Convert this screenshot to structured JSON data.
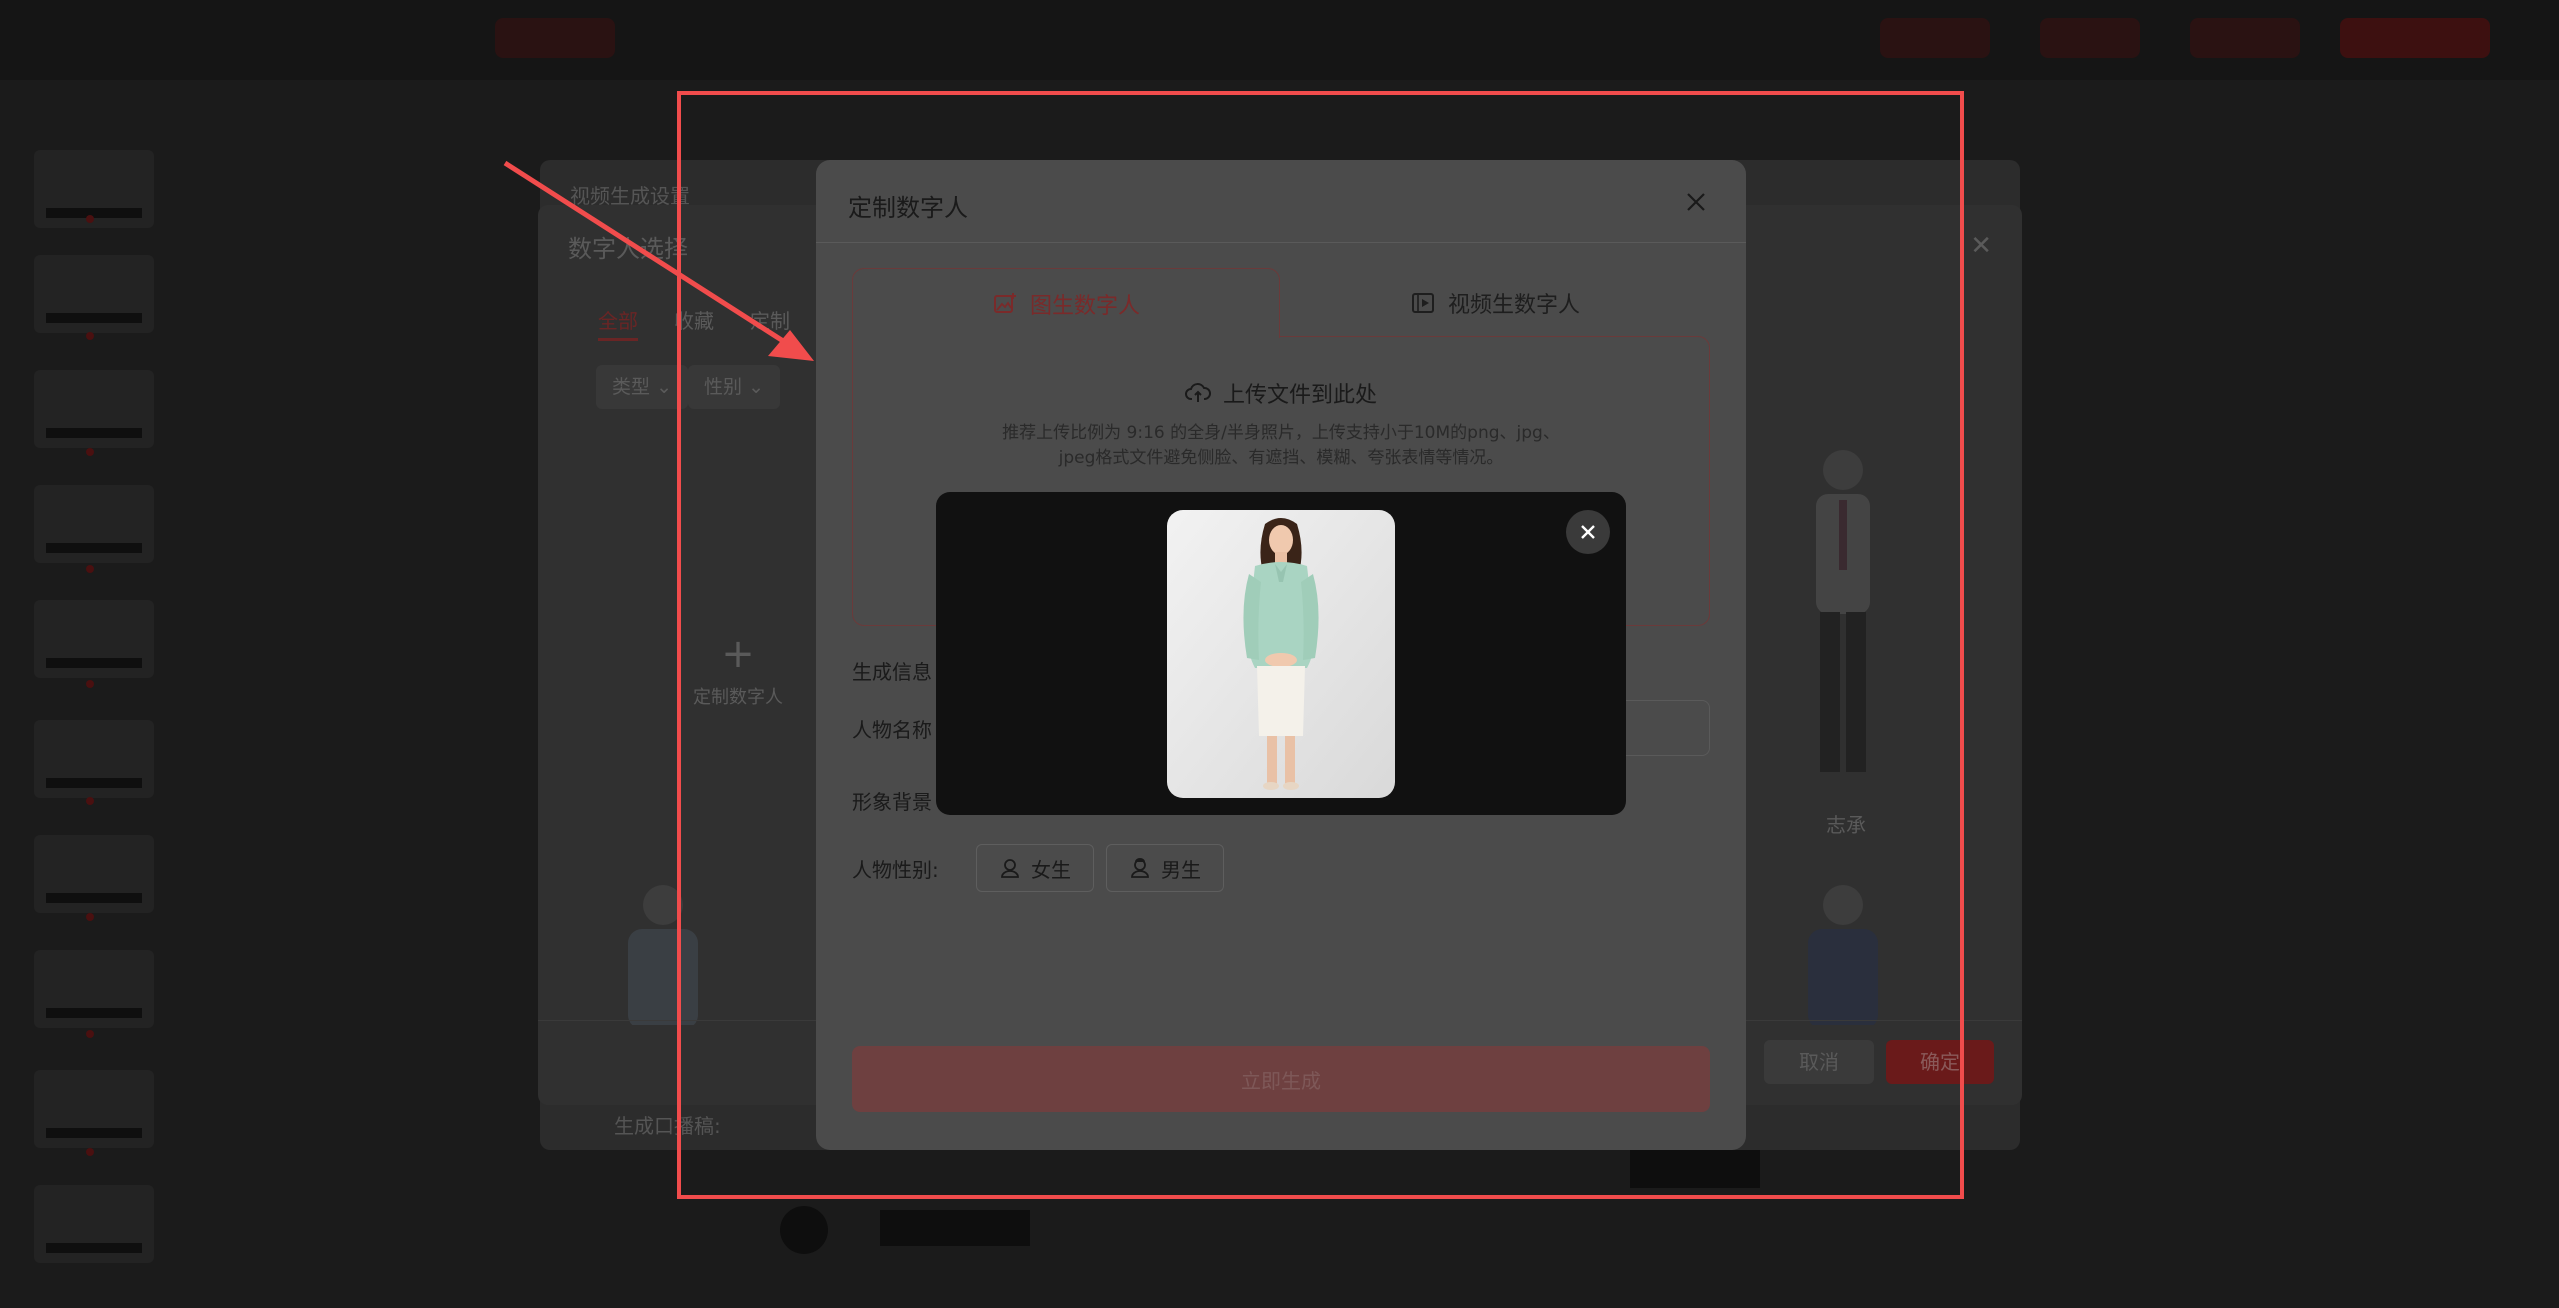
{
  "bg_app": {
    "video_dialog_title": "视频生成设置",
    "generate_script_label": "生成口播稿:",
    "select_dialog": {
      "title": "数字人选择",
      "tabs": [
        "全部",
        "收藏",
        "定制"
      ],
      "filters": [
        "类型",
        "性别"
      ],
      "add_label": "定制数字人",
      "person_name": "志承",
      "cancel_label": "取消",
      "ok_label": "确定"
    }
  },
  "dialog": {
    "title": "定制数字人",
    "tabs": [
      {
        "label": "图生数字人",
        "icon": "image-plus-icon",
        "active": true
      },
      {
        "label": "视频生数字人",
        "icon": "video-icon",
        "active": false
      }
    ],
    "upload": {
      "title": "上传文件到此处",
      "hint_line1": "推荐上传比例为 9:16 的全身/半身照片，上传支持小于10M的png、jpg、",
      "hint_line2": "jpeg格式文件避免侧脸、有遮挡、模糊、夸张表情等情况。"
    },
    "section_label": "生成信息",
    "name_label": "人物名称",
    "background_label": "形象背景",
    "gender_label": "人物性别:",
    "gender_options": [
      {
        "label": "女生",
        "icon": "female-user-icon"
      },
      {
        "label": "男生",
        "icon": "male-user-icon"
      }
    ],
    "generate_label": "立即生成"
  },
  "preview": {
    "close_icon": "close-icon"
  },
  "colors": {
    "annotation": "#f14c4c",
    "accent": "#e8453c"
  }
}
